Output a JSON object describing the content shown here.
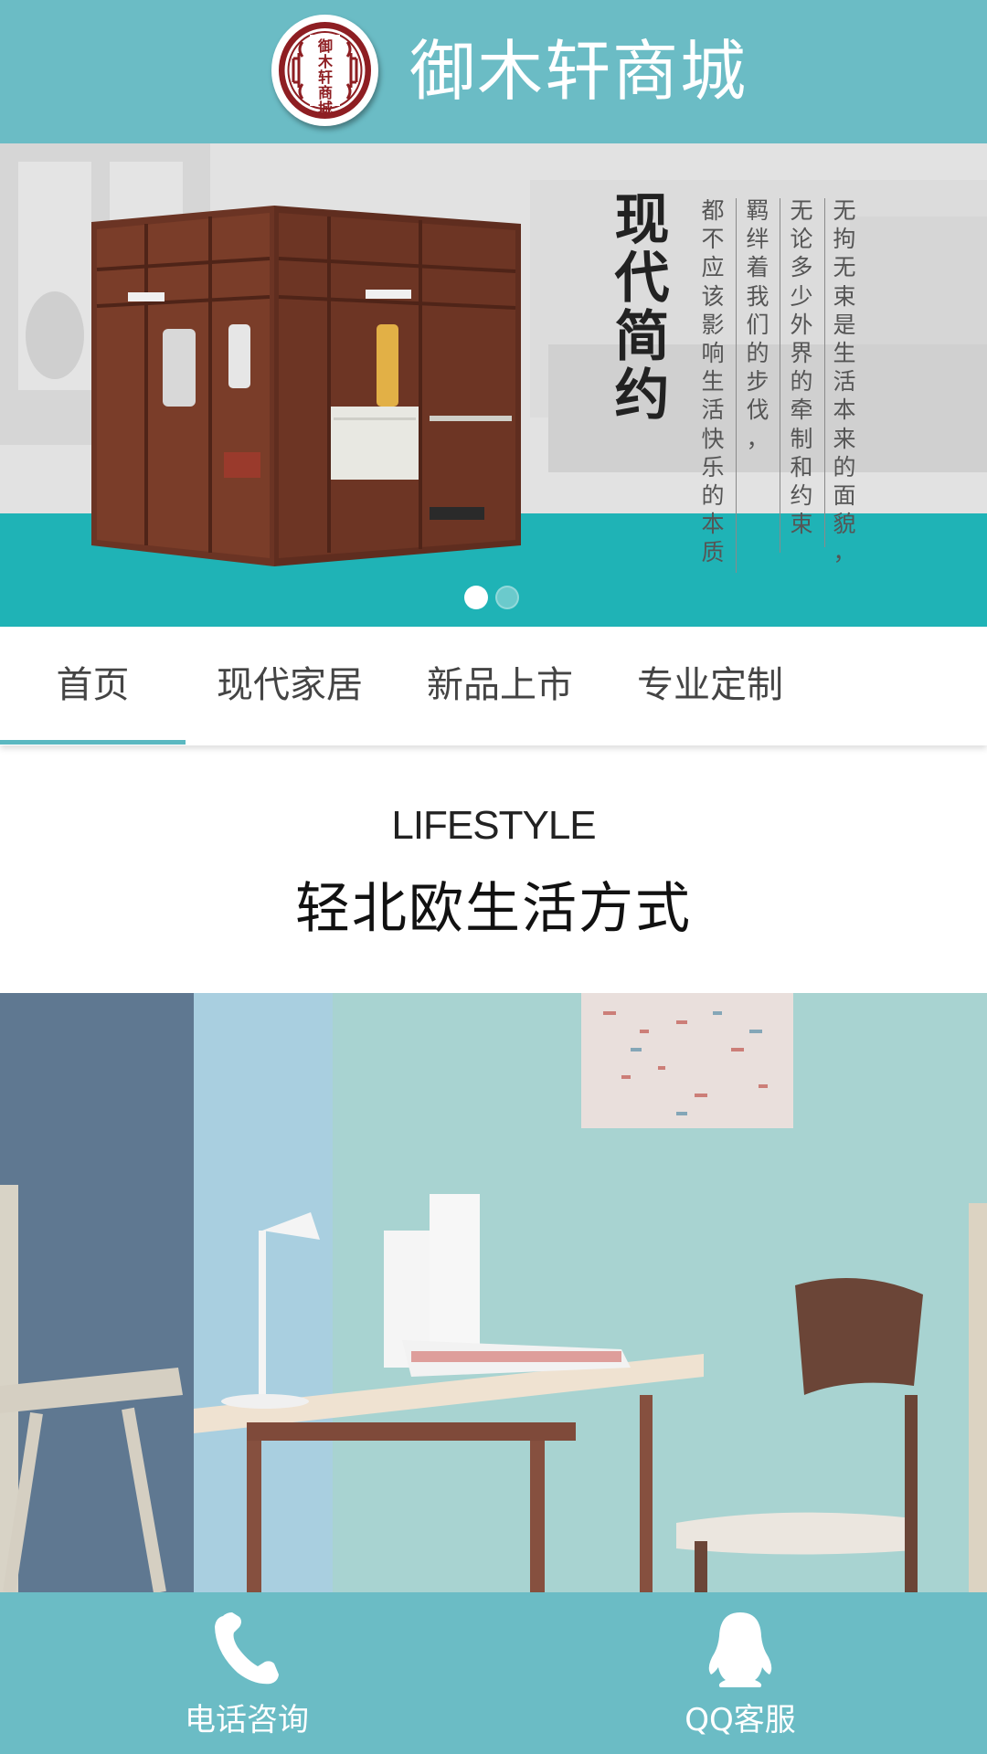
{
  "header": {
    "logo_chars": [
      "御",
      "木",
      "轩",
      "商",
      "城"
    ],
    "title": "御木轩商城",
    "background": "#6bbcc5"
  },
  "banner": {
    "headline_chars": [
      "现",
      "代",
      "简",
      "约"
    ],
    "columns": [
      "无拘无束是生活本来的面貌，",
      "无论多少外界的牵制和约束",
      "羁绊着我们的步伐，",
      "都不应该影响生活快乐的本质"
    ],
    "active_slide": 1,
    "slide_count": 2,
    "accent": "#1fb3b6"
  },
  "tabs": [
    {
      "label": "首页",
      "active": true
    },
    {
      "label": "现代家居",
      "active": false
    },
    {
      "label": "新品上市",
      "active": false
    },
    {
      "label": "专业定制",
      "active": false
    }
  ],
  "section": {
    "subtitle_en": "LIFESTYLE",
    "title_cn": "轻北欧生活方式"
  },
  "bottom_bar": {
    "phone_label": "电话咨询",
    "qq_label": "QQ客服",
    "phone_icon": "phone-icon",
    "qq_icon": "qq-penguin-icon"
  }
}
